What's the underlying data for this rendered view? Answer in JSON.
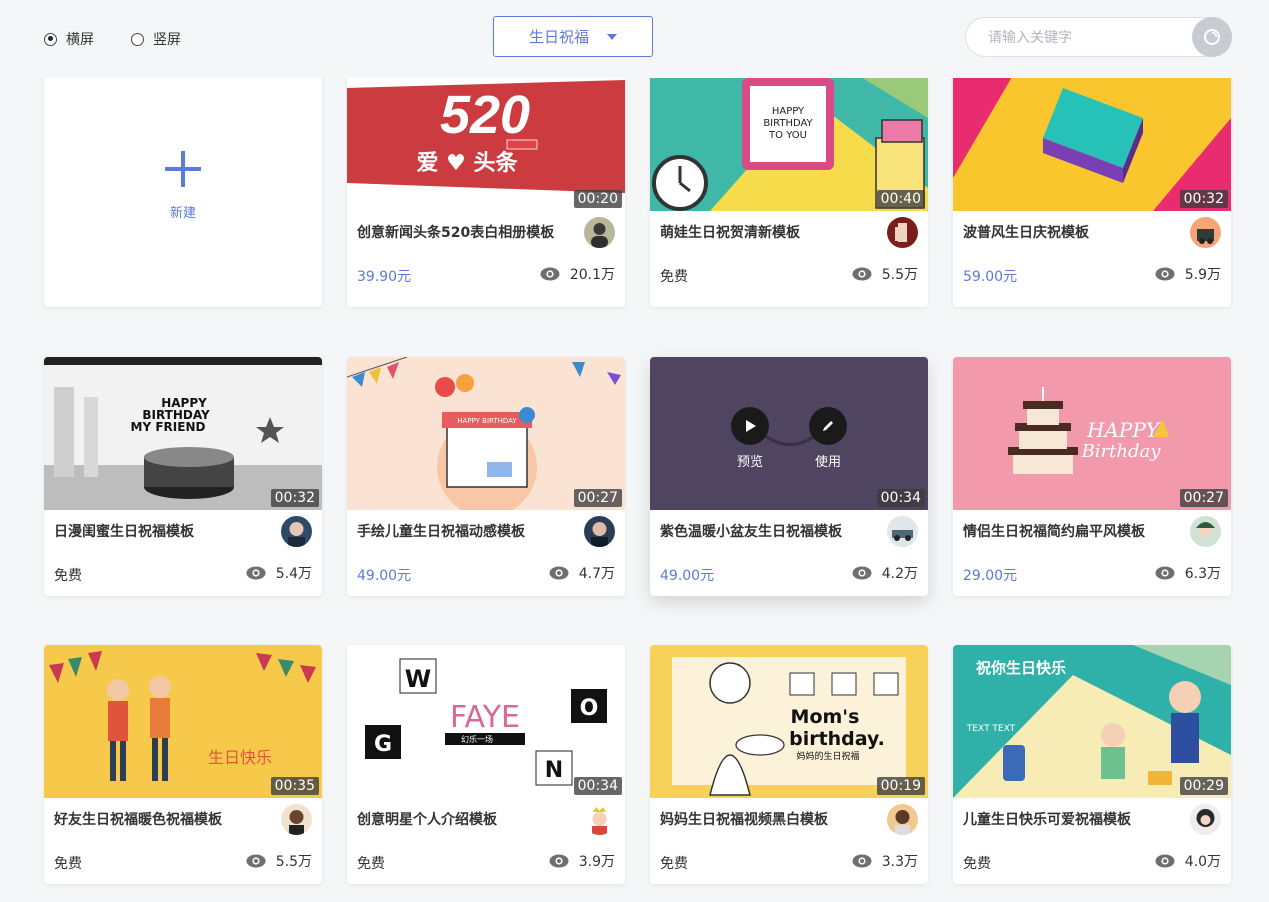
{
  "toolbar": {
    "orientation": [
      {
        "label": "横屏",
        "selected": true
      },
      {
        "label": "竖屏",
        "selected": false
      }
    ],
    "category": "生日祝福",
    "search_placeholder": "请输入关键字"
  },
  "new_card": {
    "label": "新建",
    "icon": "plus-icon"
  },
  "overlay": {
    "preview": "预览",
    "use": "使用"
  },
  "colors": {
    "accent": "#5b7ad9",
    "paid_price": "#5b7ad9"
  },
  "cards": [
    {
      "title": "创意新闻头条520表白相册模板",
      "price": "39.90元",
      "paid": true,
      "views": "20.1万",
      "duration": "00:20",
      "thumb_text": "520"
    },
    {
      "title": "萌娃生日祝贺清新模板",
      "price": "免费",
      "paid": false,
      "views": "5.5万",
      "duration": "00:40",
      "thumb_text": "HAPPY BIRTHDAY TO YOU"
    },
    {
      "title": "波普风生日庆祝模板",
      "price": "59.00元",
      "paid": true,
      "views": "5.9万",
      "duration": "00:32",
      "thumb_text": ""
    },
    {
      "title": "日漫闺蜜生日祝福模板",
      "price": "免费",
      "paid": false,
      "views": "5.4万",
      "duration": "00:32",
      "thumb_text": "HAPPY BIRTHDAY MY FRIEND"
    },
    {
      "title": "手绘儿童生日祝福动感模板",
      "price": "49.00元",
      "paid": true,
      "views": "4.7万",
      "duration": "00:27",
      "thumb_text": "HAPPY BIRTHDAY"
    },
    {
      "title": "紫色温暖小盆友生日祝福模板",
      "price": "49.00元",
      "paid": true,
      "views": "4.2万",
      "duration": "00:34",
      "thumb_text": ""
    },
    {
      "title": "情侣生日祝福简约扁平风模板",
      "price": "29.00元",
      "paid": true,
      "views": "6.3万",
      "duration": "00:27",
      "thumb_text": "HAPPY Birthday"
    },
    {
      "title": "好友生日祝福暖色祝福模板",
      "price": "免费",
      "paid": false,
      "views": "5.5万",
      "duration": "00:35",
      "thumb_text": "生日快乐"
    },
    {
      "title": "创意明星个人介绍模板",
      "price": "免费",
      "paid": false,
      "views": "3.9万",
      "duration": "00:34",
      "thumb_text": "FAYE"
    },
    {
      "title": "妈妈生日祝福视频黑白模板",
      "price": "免费",
      "paid": false,
      "views": "3.3万",
      "duration": "00:19",
      "thumb_text": "Mom's birthday."
    },
    {
      "title": "儿童生日快乐可爱祝福模板",
      "price": "免费",
      "paid": false,
      "views": "4.0万",
      "duration": "00:29",
      "thumb_text": "祝你生日快乐"
    }
  ]
}
